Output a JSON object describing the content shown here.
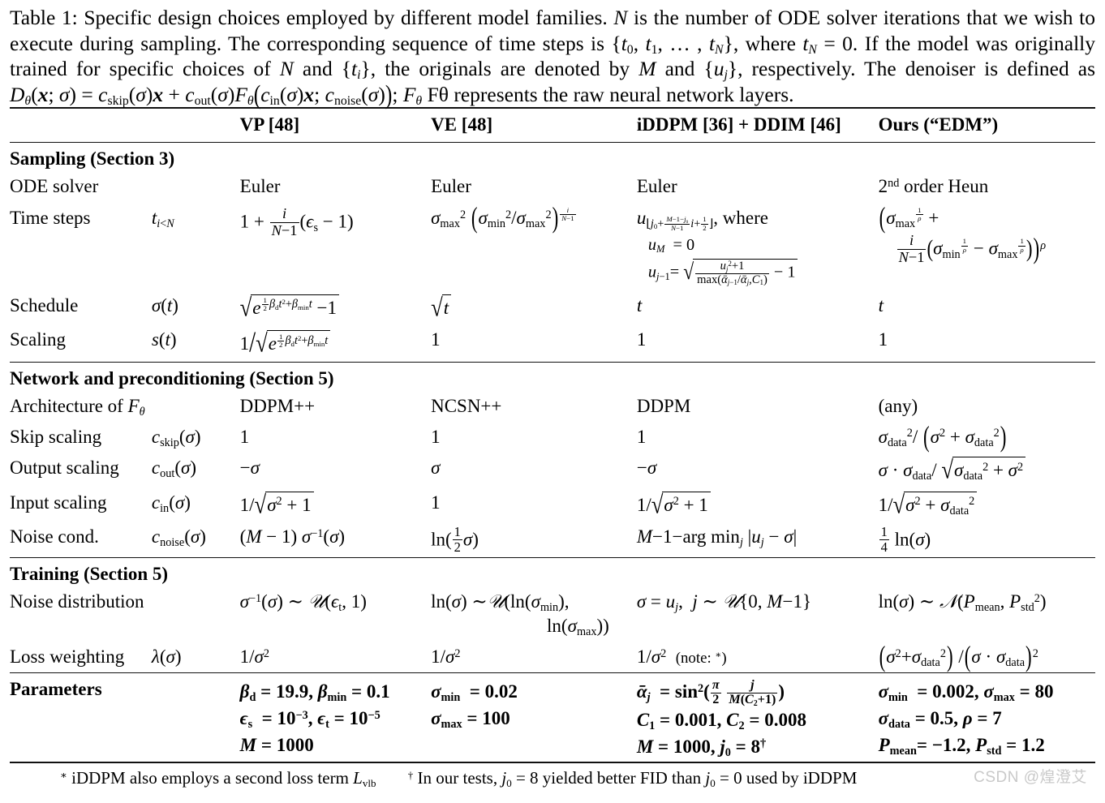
{
  "caption": {
    "label": "Table 1:",
    "text_1": "Specific design choices employed by different model families.",
    "sym_N": "N",
    "text_2": "is the number of ODE solver iterations that we wish to execute during sampling. The corresponding sequence of time steps is",
    "seq": "{t₀, t₁, … , tₙ}",
    "text_3": ", where",
    "tN_eq": "tₙ = 0.",
    "text_4": "If the model was originally trained for specific choices of",
    "sym_N2": "N",
    "text_5": "and",
    "ti_set": "{tᵢ}",
    "text_6": ", the originals are denoted by",
    "sym_M": "M",
    "text_7": "and",
    "uj_set": "{uⱼ}",
    "text_8": ", respectively. The denoiser is defined as",
    "denoiser_eq": "Dθ(x; σ) = c_skip(σ)x + c_out(σ)Fθ(c_in(σ)x; c_noise(σ));",
    "text_9": "Fθ represents the raw neural network layers."
  },
  "columns": {
    "label": "",
    "symbol": "",
    "vp": "VP [48]",
    "ve": "VE [48]",
    "iddpm": "iDDPM [36] + DDIM [46]",
    "ours": "Ours (“EDM”)"
  },
  "sections": [
    {
      "title": "Sampling (Section 3)"
    },
    {
      "title": "Network and preconditioning (Section 5)"
    },
    {
      "title": "Training (Section 5)"
    },
    {
      "title": "Parameters"
    }
  ],
  "rows": {
    "ode_solver": {
      "label": "ODE solver",
      "symbol": "",
      "vp": "Euler",
      "ve": "Euler",
      "iddpm": "Euler",
      "ours": "2nd order Heun"
    },
    "time_steps": {
      "label": "Time steps",
      "symbol": "t_{i<N}",
      "vp": "1 + i/(N−1)(ϵ_s − 1)",
      "ve": "σ²_max (σ²_min/σ²_max)^{i/(N−1)}",
      "iddpm_main": "u_{⌊j₀ + (M−1−j₀)/(N−1) i + 1/2⌋}, where",
      "iddpm_line2": "u_M = 0",
      "iddpm_line3": "u_{j−1} = sqrt( (u²_j+1)/max(ᾱ_{j−1}/ᾱ_j, C₁) − 1 )",
      "ours": "(σ_max^{1/ρ} + i/(N−1)(σ_min^{1/ρ} − σ_max^{1/ρ}))^ρ"
    },
    "schedule": {
      "label": "Schedule",
      "symbol": "σ(t)",
      "vp": "sqrt(e^{(1/2)β_d t² + β_min t} − 1)",
      "ve": "sqrt(t)",
      "iddpm": "t",
      "ours": "t"
    },
    "scaling": {
      "label": "Scaling",
      "symbol": "s(t)",
      "vp": "1/sqrt(e^{(1/2)β_d t² + β_min t})",
      "ve": "1",
      "iddpm": "1",
      "ours": "1"
    },
    "architecture": {
      "label": "Architecture of Fθ",
      "symbol": "",
      "vp": "DDPM++",
      "ve": "NCSN++",
      "iddpm": "DDPM",
      "ours": "(any)"
    },
    "skip_scaling": {
      "label": "Skip scaling",
      "symbol": "c_skip(σ)",
      "vp": "1",
      "ve": "1",
      "iddpm": "1",
      "ours": "σ²_data/(σ² + σ²_data)"
    },
    "output_scaling": {
      "label": "Output scaling",
      "symbol": "c_out(σ)",
      "vp": "−σ",
      "ve": "σ",
      "iddpm": "−σ",
      "ours": "σ · σ_data/sqrt(σ²_data + σ²)"
    },
    "input_scaling": {
      "label": "Input scaling",
      "symbol": "c_in(σ)",
      "vp": "1/sqrt(σ² + 1)",
      "ve": "1",
      "iddpm": "1/sqrt(σ² + 1)",
      "ours": "1/sqrt(σ² + σ²_data)"
    },
    "noise_cond": {
      "label": "Noise cond.",
      "symbol": "c_noise(σ)",
      "vp": "(M − 1) σ⁻¹(σ)",
      "ve": "ln((1/2)σ)",
      "iddpm": "M − 1 − arg min_j |u_j − σ|",
      "ours": "(1/4) ln(σ)"
    },
    "noise_distribution": {
      "label": "Noise distribution",
      "symbol": "",
      "vp": "σ⁻¹(σ) ~ U(ϵ_t, 1)",
      "ve": "ln(σ) ~ U(ln(σ_min), ln(σ_max))",
      "iddpm": "σ = u_j,  j ~ U{0, M−1}",
      "ours": "ln(σ) ~ N(P_mean, P²_std)"
    },
    "loss_weighting": {
      "label": "Loss weighting",
      "symbol": "λ(σ)",
      "vp": "1/σ²",
      "ve": "1/σ²",
      "iddpm": "1/σ²  (note: *)",
      "ours": "(σ² + σ²_data)/(σ · σ_data)²"
    },
    "parameters": {
      "label": "Parameters",
      "vp_lines": [
        "β_d = 19.9, β_min = 0.1",
        "ϵ_s = 10⁻³, ϵ_t = 10⁻⁵",
        "M = 1000"
      ],
      "ve_lines": [
        "σ_min = 0.02",
        "σ_max = 100",
        ""
      ],
      "iddpm_lines": [
        "ᾱ_j = sin²((π/2) j/(M(C₂+1)))",
        "C₁ = 0.001, C₂ = 0.008",
        "M = 1000, j₀ = 8†"
      ],
      "ours_lines": [
        "σ_min = 0.002, σ_max = 80",
        "σ_data = 0.5, ρ = 7",
        "P_mean = −1.2, P_std = 1.2"
      ]
    }
  },
  "footnotes": {
    "star": "* iDDPM also employs a second loss term L_vlb",
    "dagger": "† In our tests, j₀ = 8 yielded better FID than j₀ = 0 used by iDDPM"
  },
  "watermark": "CSDN @煌澄艾"
}
